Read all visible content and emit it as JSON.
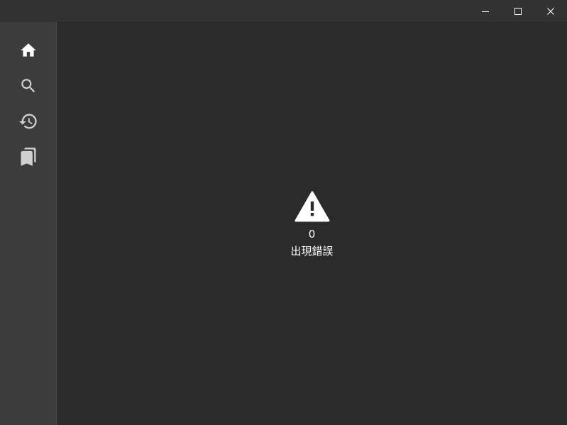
{
  "titlebar": {
    "buttons": [
      {
        "name": "minimize",
        "icon": "minimize-icon"
      },
      {
        "name": "maximize",
        "icon": "maximize-icon"
      },
      {
        "name": "close",
        "icon": "close-icon"
      }
    ],
    "background": "#323232",
    "icon_color": "#ffffff"
  },
  "sidebar": {
    "background": "#3c3c3c",
    "items": [
      {
        "name": "home",
        "icon": "home-icon",
        "active": true
      },
      {
        "name": "search",
        "icon": "search-icon",
        "active": false
      },
      {
        "name": "history",
        "icon": "history-icon",
        "active": false
      },
      {
        "name": "bookmarks",
        "icon": "bookmarks-icon",
        "active": false
      }
    ],
    "active_icon_color": "#ffffff",
    "inactive_icon_color": "#d0d0d0"
  },
  "main": {
    "background": "#2b2b2b",
    "error": {
      "icon": "warning-icon",
      "code": "0",
      "message": "出現錯誤"
    }
  }
}
